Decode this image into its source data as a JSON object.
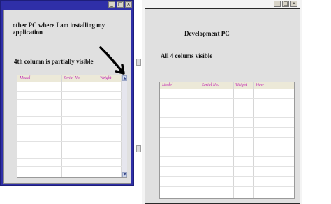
{
  "window_controls": {
    "minimize": "_",
    "maximize": "□",
    "close": "×"
  },
  "left_window": {
    "heading": "other PC where I am installing my application",
    "note": "4th column is partially visible",
    "columns": [
      "Model",
      "Serial No.",
      "Weight"
    ],
    "scroll_up": "▲",
    "scroll_down": "▼"
  },
  "right_window": {
    "heading": "Development PC",
    "note": "All 4 colums visible",
    "columns": [
      "Model",
      "Serial No.",
      "Weight",
      "View"
    ]
  },
  "colors": {
    "left_frame": "#2f2fa8",
    "client_bg": "#e0e0e0",
    "column_header_text": "#c020b0",
    "arrow": "#000000"
  }
}
